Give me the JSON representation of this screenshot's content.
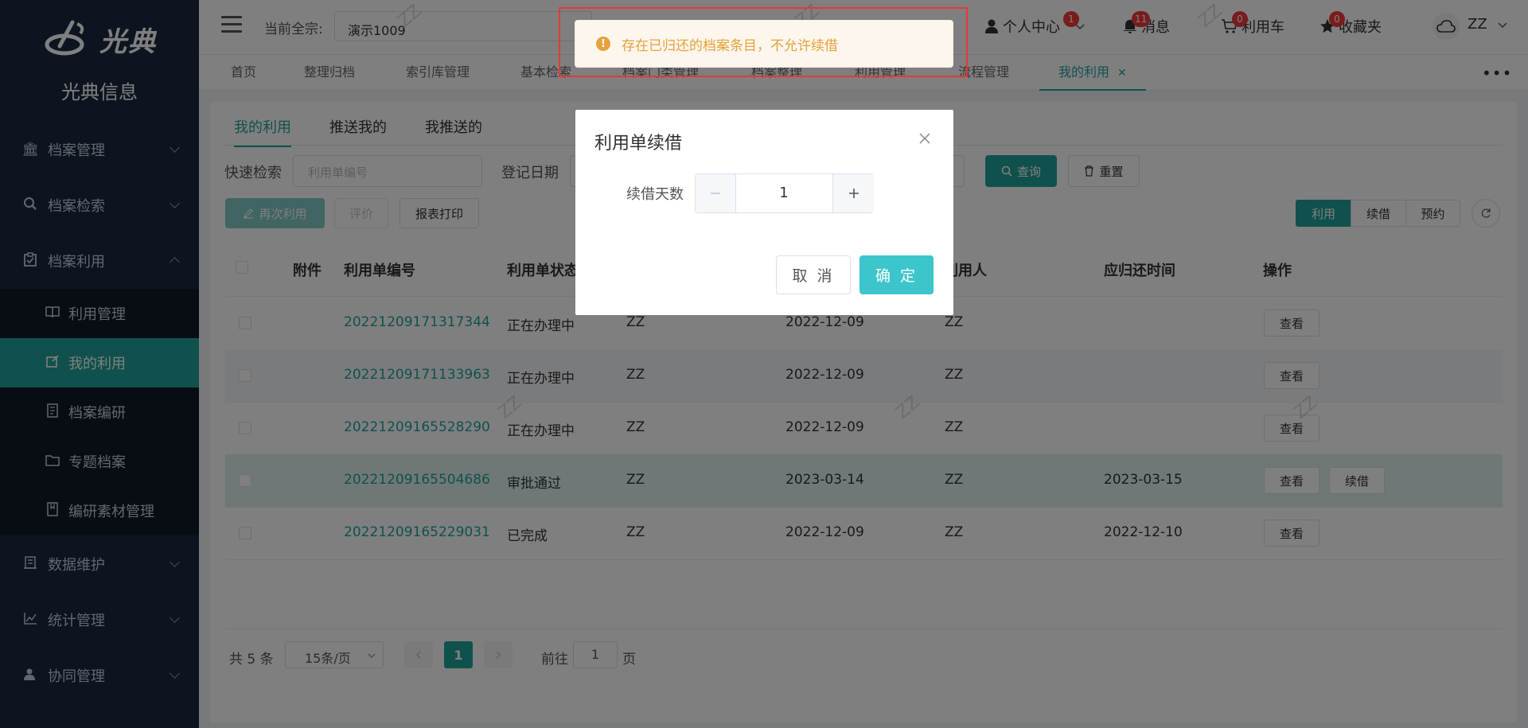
{
  "sidebar": {
    "brand": "光典",
    "system_name": "光典信息",
    "items": [
      {
        "label": "档案管理",
        "icon": "bank-icon"
      },
      {
        "label": "档案检索",
        "icon": "search-icon"
      },
      {
        "label": "档案利用",
        "icon": "clipboard-check-icon"
      }
    ],
    "sub_items": [
      {
        "label": "利用管理",
        "icon": "book-icon"
      },
      {
        "label": "我的利用",
        "icon": "edit-square-icon"
      },
      {
        "label": "档案编研",
        "icon": "notebook-icon"
      },
      {
        "label": "专题档案",
        "icon": "folder-icon"
      },
      {
        "label": "编研素材管理",
        "icon": "book-marked-icon"
      }
    ],
    "items_after": [
      {
        "label": "数据维护",
        "icon": "building-icon"
      },
      {
        "label": "统计管理",
        "icon": "chart-line-icon"
      },
      {
        "label": "协同管理",
        "icon": "user-group-icon"
      }
    ]
  },
  "header": {
    "current_label": "当前全宗:",
    "current_value": "演示1009",
    "personal_center": "个人中心",
    "personal_badge": "1",
    "messages": "消息",
    "messages_badge": "11",
    "cart": "利用车",
    "cart_badge": "0",
    "favorites": "收藏夹",
    "favorites_badge": "0",
    "user": "ZZ"
  },
  "page_tabs": [
    "首页",
    "整理归档",
    "索引库管理",
    "基本检索",
    "档案门类管理",
    "档案整理",
    "利用管理",
    "流程管理",
    "我的利用"
  ],
  "sub_tabs": [
    "我的利用",
    "推送我的",
    "我推送的"
  ],
  "filters": {
    "quick_search_label": "快速检索",
    "quick_search_placeholder": "利用单编号",
    "date_label": "登记日期",
    "query_btn": "查询",
    "reset_btn": "重置"
  },
  "toolbar": {
    "reuse_btn": "再次利用",
    "rate_btn": "评价",
    "print_btn": "报表打印",
    "seg": [
      "利用",
      "续借",
      "预约"
    ]
  },
  "table": {
    "headers": [
      "附件",
      "利用单编号",
      "利用单状态",
      "利用人",
      "应归还时间",
      "操作"
    ],
    "rows": [
      {
        "id": "20221209171317344",
        "status": "正在办理中",
        "a": "ZZ",
        "date": "2022-12-09",
        "user": "ZZ",
        "due": "",
        "ops": [
          "查看"
        ]
      },
      {
        "id": "20221209171133963",
        "status": "正在办理中",
        "a": "ZZ",
        "date": "2022-12-09",
        "user": "ZZ",
        "due": "",
        "ops": [
          "查看"
        ]
      },
      {
        "id": "20221209165528290",
        "status": "正在办理中",
        "a": "ZZ",
        "date": "2022-12-09",
        "user": "ZZ",
        "due": "",
        "ops": [
          "查看"
        ]
      },
      {
        "id": "20221209165504686",
        "status": "审批通过",
        "a": "ZZ",
        "date": "2023-03-14",
        "user": "ZZ",
        "due": "2023-03-15",
        "ops": [
          "查看",
          "续借"
        ]
      },
      {
        "id": "20221209165229031",
        "status": "已完成",
        "a": "ZZ",
        "date": "2022-12-09",
        "user": "ZZ",
        "due": "2022-12-10",
        "ops": [
          "查看"
        ]
      }
    ]
  },
  "pager": {
    "total": "共 5 条",
    "size": "15条/页",
    "current": "1",
    "goto_label": "前往",
    "goto_value": "1",
    "goto_suffix": "页"
  },
  "modal": {
    "title": "利用单续借",
    "days_label": "续借天数",
    "days_value": "1",
    "cancel": "取 消",
    "ok": "确 定"
  },
  "message": {
    "text": "存在已归还的档案条目，不允许续借",
    "type": "warning"
  },
  "watermark": "ZZ",
  "colors": {
    "accent": "#20a29b",
    "sidebar": "#1a2940",
    "warning": "#e6a23c"
  }
}
